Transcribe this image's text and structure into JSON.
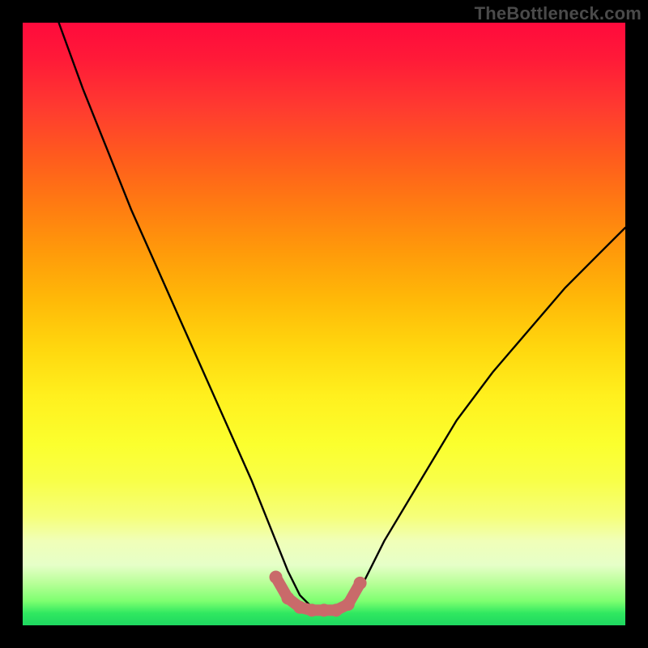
{
  "watermark": "TheBottleneck.com",
  "chart_data": {
    "type": "line",
    "title": "",
    "xlabel": "",
    "ylabel": "",
    "xlim": [
      0,
      100
    ],
    "ylim": [
      0,
      100
    ],
    "series": [
      {
        "name": "bottleneck-curve",
        "x": [
          6,
          10,
          14,
          18,
          22,
          26,
          30,
          34,
          38,
          42,
          44,
          46,
          48,
          50,
          52,
          54,
          56,
          60,
          66,
          72,
          78,
          84,
          90,
          96,
          100
        ],
        "values": [
          100,
          89,
          79,
          69,
          60,
          51,
          42,
          33,
          24,
          14,
          9,
          5,
          3,
          2.5,
          2.5,
          3,
          6,
          14,
          24,
          34,
          42,
          49,
          56,
          62,
          66
        ]
      },
      {
        "name": "valley-highlight",
        "x": [
          42,
          44,
          46,
          48,
          50,
          52,
          54,
          56
        ],
        "values": [
          8,
          4.5,
          3,
          2.5,
          2.5,
          2.5,
          3.5,
          7
        ]
      }
    ],
    "colors": {
      "curve": "#000000",
      "highlight": "#c96a6a"
    }
  }
}
